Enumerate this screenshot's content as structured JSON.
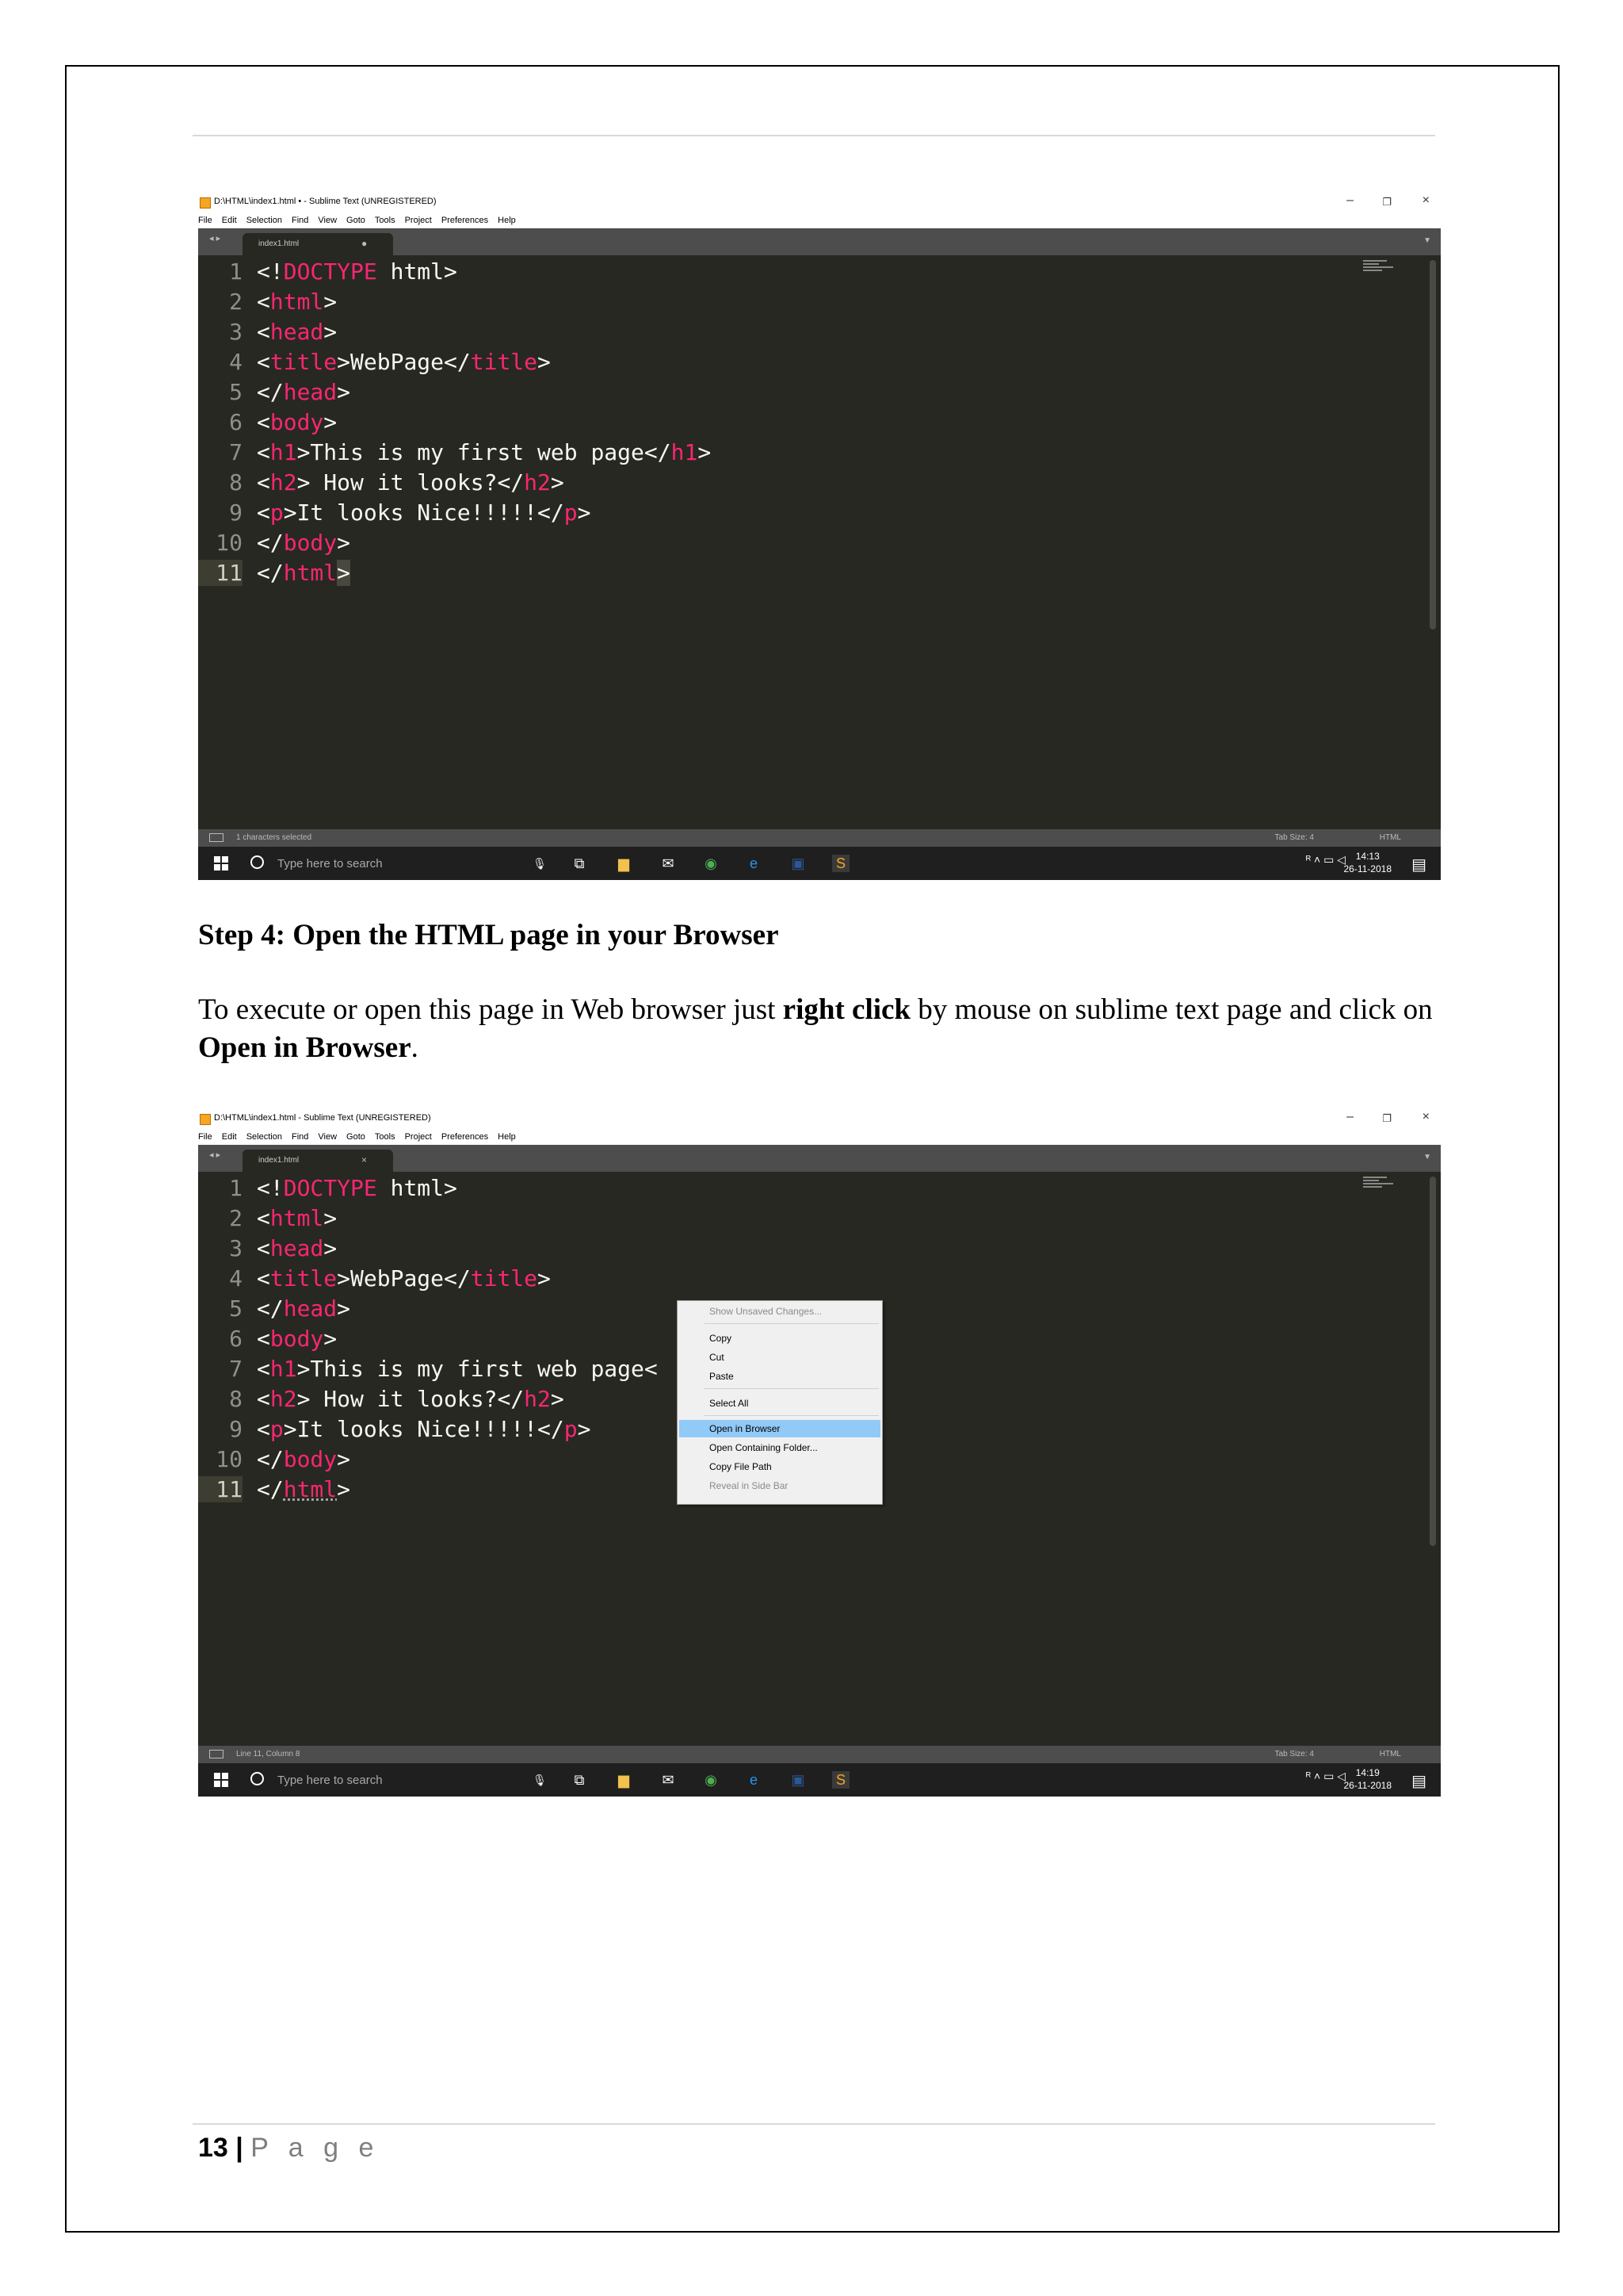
{
  "screenshot1": {
    "window_title": "D:\\HTML\\index1.html • - Sublime Text (UNREGISTERED)",
    "menu": [
      "File",
      "Edit",
      "Selection",
      "Find",
      "View",
      "Goto",
      "Tools",
      "Project",
      "Preferences",
      "Help"
    ],
    "tab_name": "index1.html",
    "tab_marker": "●",
    "status_left": "1 characters selected",
    "status_tab": "Tab Size: 4",
    "status_syntax": "HTML",
    "search_placeholder": "Type here to search",
    "clock_time": "14:13",
    "clock_date": "26-11-2018"
  },
  "screenshot2": {
    "window_title": "D:\\HTML\\index1.html - Sublime Text (UNREGISTERED)",
    "menu": [
      "File",
      "Edit",
      "Selection",
      "Find",
      "View",
      "Goto",
      "Tools",
      "Project",
      "Preferences",
      "Help"
    ],
    "tab_name": "index1.html",
    "tab_marker": "×",
    "status_left": "Line 11, Column 8",
    "status_tab": "Tab Size: 4",
    "status_syntax": "HTML",
    "search_placeholder": "Type here to search",
    "clock_time": "14:19",
    "clock_date": "26-11-2018",
    "context_menu": {
      "show_unsaved": "Show Unsaved Changes...",
      "copy": "Copy",
      "cut": "Cut",
      "paste": "Paste",
      "select_all": "Select All",
      "open_in_browser": "Open in Browser",
      "open_folder": "Open Containing Folder...",
      "copy_path": "Copy File Path",
      "reveal": "Reveal in Side Bar"
    }
  },
  "code": {
    "line_numbers": [
      "1",
      "2",
      "3",
      "4",
      "5",
      "6",
      "7",
      "8",
      "9",
      "10",
      "11"
    ],
    "l1a": "<!",
    "l1b": "DOCTYPE",
    "l1c": " html>",
    "l2a": "<",
    "l2b": "html",
    "l2c": ">",
    "l3a": "<",
    "l3b": "head",
    "l3c": ">",
    "l4a": "<",
    "l4b": "title",
    "l4c": ">WebPage</",
    "l4d": "title",
    "l4e": ">",
    "l5a": "</",
    "l5b": "head",
    "l5c": ">",
    "l6a": "<",
    "l6b": "body",
    "l6c": ">",
    "l7a": "<",
    "l7b": "h1",
    "l7c": ">This is my first web page</",
    "l7d": "h1",
    "l7e": ">",
    "l7_truncated": ">This is my first web page<",
    "l8a": "<",
    "l8b": "h2",
    "l8c": "> How it looks?</",
    "l8d": "h2",
    "l8e": ">",
    "l9a": "<",
    "l9b": "p",
    "l9c": ">It looks Nice!!!!!</",
    "l9d": "p",
    "l9e": ">",
    "l10a": "</",
    "l10b": "body",
    "l10c": ">",
    "l11a": "</",
    "l11b": "html",
    "l11c": ">"
  },
  "step_heading": "Step 4: Open the HTML page in your Browser",
  "paragraph": {
    "t1": "To execute or open this page in Web browser just ",
    "b1": "right click",
    "t2": " by mouse on sublime text page and click on ",
    "b2": "Open in Browser",
    "t3": "."
  },
  "footer": {
    "page_number": "13",
    "separator": " | ",
    "page_label": "P a g e"
  }
}
